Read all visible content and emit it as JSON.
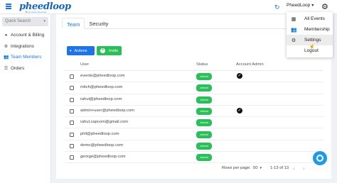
{
  "topbar": {
    "logo": "pheedloop",
    "logo_sub": "Business Events",
    "refresh_icon": "refresh-icon",
    "user_label": "PheedLoop",
    "user_chevron": "▾",
    "settings_icon": "gear-icon"
  },
  "sidebar": {
    "search_placeholder": "Quick Search",
    "search_caret": "▾",
    "items": [
      {
        "label": "Account & Billing",
        "icon": "user-icon",
        "glyph": "●",
        "active": false
      },
      {
        "label": "Integrations",
        "icon": "integrations-icon",
        "glyph": "⚙",
        "active": false
      },
      {
        "label": "Team Members",
        "icon": "team-icon",
        "glyph": "👥",
        "active": true
      },
      {
        "label": "Orders",
        "icon": "orders-icon",
        "glyph": "☰",
        "active": false
      }
    ]
  },
  "tabs": [
    {
      "label": "Team",
      "active": true
    },
    {
      "label": "Security",
      "active": false
    }
  ],
  "toolbar": {
    "actions_label": "Actions",
    "actions_caret": "▾",
    "invite_label": "Invite",
    "invite_plus": "+"
  },
  "table": {
    "columns": [
      "User",
      "Status",
      "Account Admin"
    ],
    "rows": [
      {
        "email": "events@pheedloop.com",
        "status": "Joined",
        "admin": true
      },
      {
        "email": "mitch@pheedloop.com",
        "status": "Joined",
        "admin": false
      },
      {
        "email": "rahul@pheedloop.com",
        "status": "Joined",
        "admin": false
      },
      {
        "email": "admin+user@pheedloop.com",
        "status": "Joined",
        "admin": true
      },
      {
        "email": "rahul.capcom@gmail.com",
        "status": "Joined",
        "admin": false
      },
      {
        "email": "phil@pheedloop.com",
        "status": "Joined",
        "admin": false
      },
      {
        "email": "demo@pheedloop.com",
        "status": "Joined",
        "admin": false
      },
      {
        "email": "george@pheedloop.com",
        "status": "Joined",
        "admin": false
      }
    ],
    "admin_check": "✓"
  },
  "footer": {
    "rows_per_page_label": "Rows per page:",
    "rows_per_page_value": "50",
    "rows_caret": "▾",
    "range": "1-13 of 13",
    "prev": "‹",
    "next": "›"
  },
  "menu": {
    "items": [
      {
        "label": "All Events",
        "icon": "calendar-icon",
        "glyph": "▦"
      },
      {
        "label": "Membership",
        "icon": "people-icon",
        "glyph": "👥"
      },
      {
        "label": "Settings",
        "icon": "gear-icon",
        "glyph": "⚙"
      },
      {
        "label": "Logout",
        "icon": "logout-icon",
        "glyph": ""
      }
    ],
    "hovered": "Settings"
  },
  "colors": {
    "accent": "#1d74e8",
    "success": "#2bbf5a",
    "chat": "#1d9be8"
  }
}
